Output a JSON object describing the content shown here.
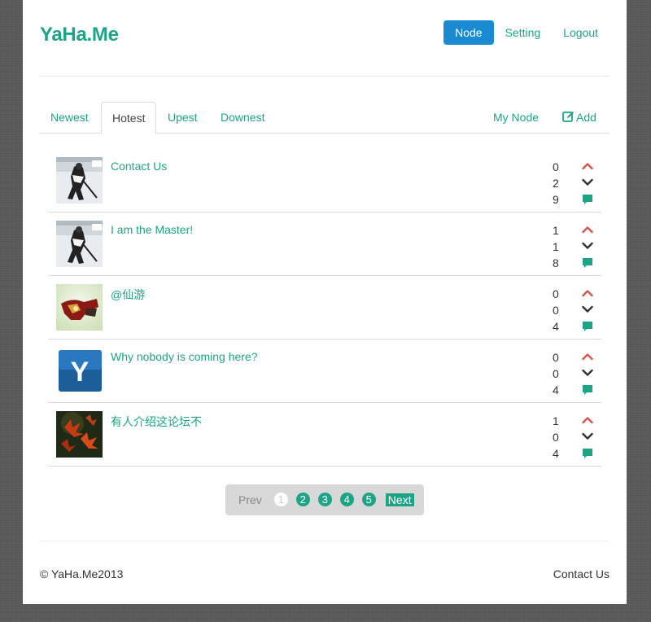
{
  "brand": "YaHa.Me",
  "topnav": {
    "node": "Node",
    "setting": "Setting",
    "logout": "Logout"
  },
  "tabs": {
    "newest": "Newest",
    "hotest": "Hotest",
    "upest": "Upest",
    "downest": "Downest",
    "my_node": "My Node",
    "add": "Add"
  },
  "colors": {
    "accent": "#1fa386",
    "nav_active": "#1a8bd0",
    "upvote": "#d9534f",
    "downvote": "#333333"
  },
  "posts": [
    {
      "title": "Contact Us",
      "up": "0",
      "down": "2",
      "comments": "9",
      "avatar": "hockey-player"
    },
    {
      "title": "I am the Master!",
      "up": "1",
      "down": "1",
      "comments": "8",
      "avatar": "hockey-player"
    },
    {
      "title": "@仙游",
      "up": "0",
      "down": "0",
      "comments": "4",
      "avatar": "iron-man"
    },
    {
      "title": "Why nobody is coming here?",
      "up": "0",
      "down": "0",
      "comments": "4",
      "avatar": "blue-y-logo"
    },
    {
      "title": "有人介绍这论坛不",
      "up": "1",
      "down": "0",
      "comments": "4",
      "avatar": "red-leaves"
    }
  ],
  "pager": {
    "prev": "Prev",
    "pages": [
      "1",
      "2",
      "3",
      "4",
      "5"
    ],
    "current": "1",
    "next": "Next"
  },
  "footer": {
    "copyright": "© YaHa.Me2013",
    "contact": "Contact Us"
  }
}
